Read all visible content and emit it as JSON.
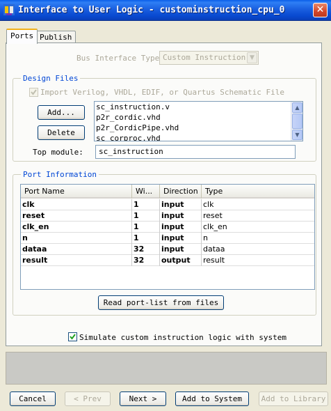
{
  "window": {
    "title": "Interface to User Logic - custominstruction_cpu_0",
    "close_glyph": "✕"
  },
  "tabs": [
    {
      "label": "Ports",
      "active": true
    },
    {
      "label": "Publish",
      "active": false
    }
  ],
  "bus_interface": {
    "label": "Bus Interface Type:",
    "value": "Custom Instruction"
  },
  "design_files": {
    "legend": "Design Files",
    "import_label": "Import Verilog, VHDL, EDIF, or Quartus Schematic File",
    "import_checked": true,
    "add_button": "Add...",
    "delete_button": "Delete",
    "files": [
      "sc_instruction.v",
      "p2r_cordic.vhd",
      "p2r_CordicPipe.vhd",
      "sc_corproc.vhd"
    ],
    "top_module_label": "Top module:",
    "top_module_value": "sc_instruction"
  },
  "port_information": {
    "legend": "Port Information",
    "columns": [
      "Port Name",
      "Wi...",
      "Direction",
      "Type"
    ],
    "rows": [
      {
        "name": "clk",
        "width": "1",
        "direction": "input",
        "type": "clk"
      },
      {
        "name": "reset",
        "width": "1",
        "direction": "input",
        "type": "reset"
      },
      {
        "name": "clk_en",
        "width": "1",
        "direction": "input",
        "type": "clk_en"
      },
      {
        "name": "n",
        "width": "1",
        "direction": "input",
        "type": "n"
      },
      {
        "name": "dataa",
        "width": "32",
        "direction": "input",
        "type": "dataa"
      },
      {
        "name": "result",
        "width": "32",
        "direction": "output",
        "type": "result"
      }
    ],
    "read_button": "Read port-list from files"
  },
  "simulate": {
    "label": "Simulate custom instruction logic with system",
    "checked": true
  },
  "footer": {
    "cancel": "Cancel",
    "prev": "< Prev",
    "next": "Next >",
    "add_to_system": "Add to System",
    "add_to_library": "Add to Library"
  },
  "colors": {
    "titlebar": "#0a5ee8",
    "group_legend": "#0046d5",
    "window_bg": "#ece9d8"
  }
}
